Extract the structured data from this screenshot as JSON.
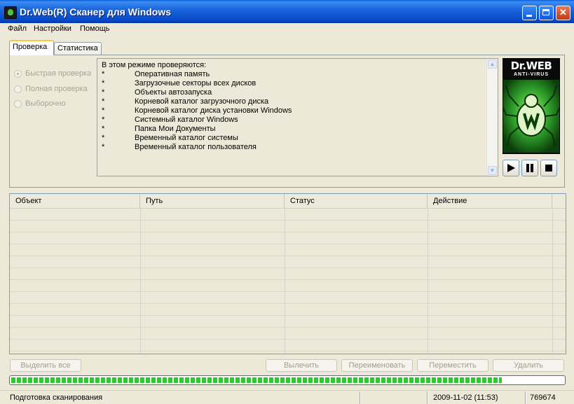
{
  "window": {
    "title": "Dr.Web(R) Сканер для Windows"
  },
  "menu": [
    "Файл",
    "Настройки",
    "Помощь"
  ],
  "tabs": [
    {
      "label": "Проверка",
      "active": true
    },
    {
      "label": "Статистика",
      "active": false
    }
  ],
  "scan_modes": [
    {
      "label": "Быстрая проверка",
      "selected": true
    },
    {
      "label": "Полная проверка",
      "selected": false
    },
    {
      "label": "Выборочно",
      "selected": false
    }
  ],
  "info": {
    "heading": "В этом режиме проверяются:",
    "bullet": "*",
    "items": [
      "Оперативная память",
      "Загрузочные секторы всех дисков",
      "Объекты автозапуска",
      "Корневой каталог загрузочного диска",
      "Корневой каталог диска установки Windows",
      "Системный каталог Windows",
      "Папка Мои Документы",
      "Временный каталог системы",
      "Временный каталог пользователя"
    ]
  },
  "logo": {
    "title": "Dr.WEB",
    "subtitle": "ANTI-VIRUS",
    "icon": "spider-logo"
  },
  "controls": {
    "play_icon": "play-icon",
    "pause_icon": "pause-icon",
    "stop_icon": "stop-icon"
  },
  "table": {
    "columns": [
      "Объект",
      "Путь",
      "Статус",
      "Действие"
    ],
    "rows": []
  },
  "buttons": {
    "select_all": "Выделить все",
    "cure": "Вылечить",
    "rename": "Переименовать",
    "move": "Переместить",
    "delete": "Удалить"
  },
  "progress": {
    "fraction": 0.89
  },
  "status": {
    "text": "Подготовка сканирования",
    "datetime": "2009-11-02 (11:53)",
    "count": "769674"
  },
  "colors": {
    "titlebar": "#0A5FD8",
    "progress": "#2CCB2C",
    "tab_highlight": "#FFC83C"
  }
}
